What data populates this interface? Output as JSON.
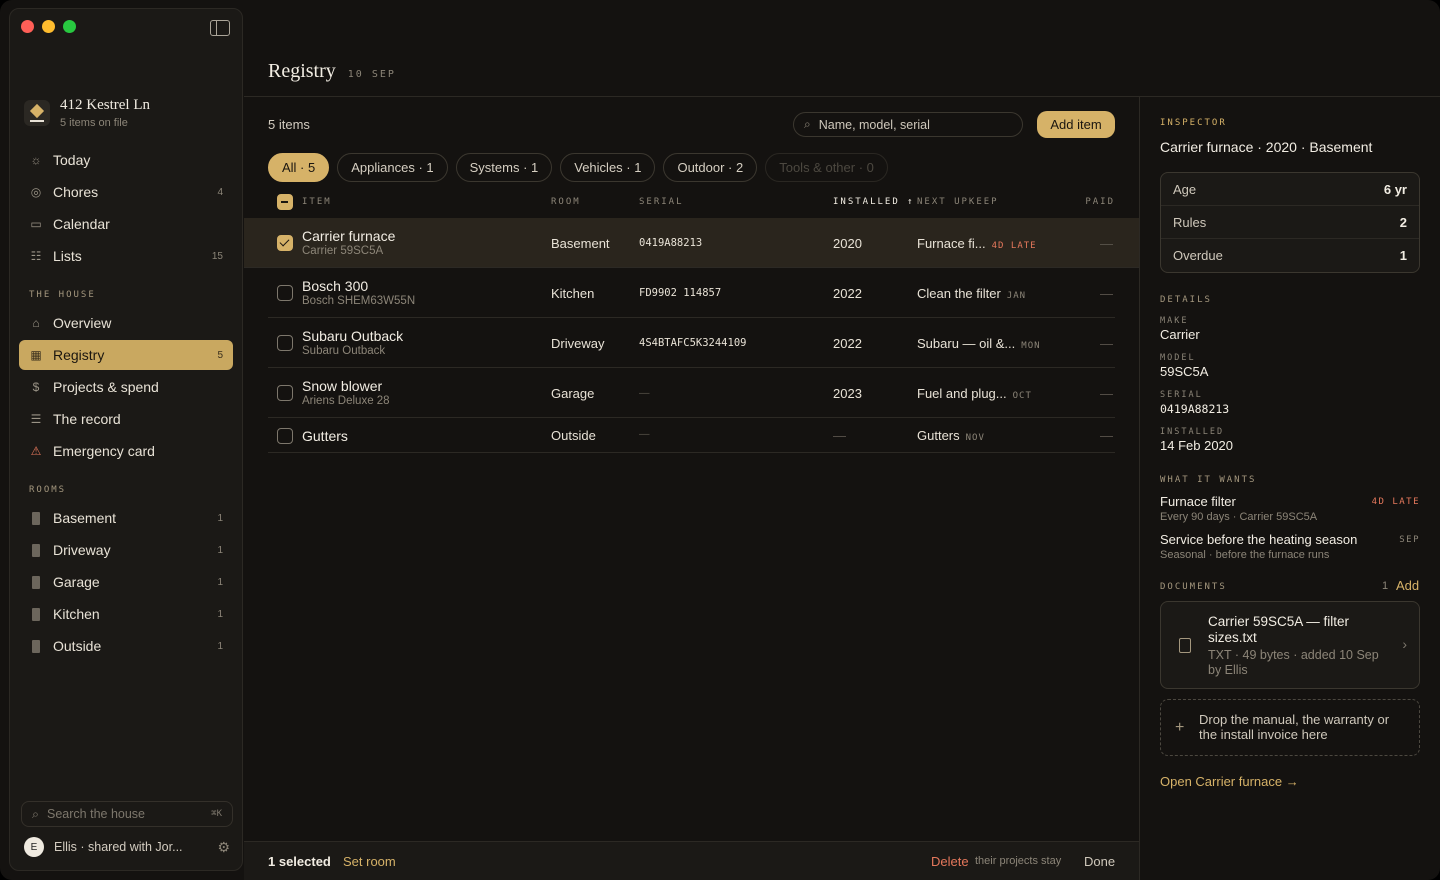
{
  "sidebar": {
    "house_name": "412 Kestrel Ln",
    "house_sub": "5 items on file",
    "nav": [
      {
        "label": "Today",
        "count": "",
        "icon": "sun-icon"
      },
      {
        "label": "Chores",
        "count": "4",
        "icon": "check-circle-icon"
      },
      {
        "label": "Calendar",
        "count": "",
        "icon": "calendar-icon"
      },
      {
        "label": "Lists",
        "count": "15",
        "icon": "list-icon"
      }
    ],
    "section_house": "THE HOUSE",
    "house_nav": [
      {
        "label": "Overview",
        "count": "",
        "icon": "home-icon"
      },
      {
        "label": "Registry",
        "count": "5",
        "icon": "grid-icon"
      },
      {
        "label": "Projects & spend",
        "count": "",
        "icon": "dollar-icon"
      },
      {
        "label": "The record",
        "count": "",
        "icon": "lines-icon"
      },
      {
        "label": "Emergency card",
        "count": "",
        "icon": "warning-icon"
      }
    ],
    "section_rooms": "ROOMS",
    "rooms": [
      {
        "label": "Basement",
        "count": "1"
      },
      {
        "label": "Driveway",
        "count": "1"
      },
      {
        "label": "Garage",
        "count": "1"
      },
      {
        "label": "Kitchen",
        "count": "1"
      },
      {
        "label": "Outside",
        "count": "1"
      }
    ],
    "search_placeholder": "Search the house",
    "search_kbd": "⌘K",
    "user_initial": "E",
    "user_label": "Ellis · shared with Jor..."
  },
  "header": {
    "title": "Registry",
    "date": "10 SEP"
  },
  "toolbar": {
    "item_count": "5 items",
    "search_placeholder": "Name, model, serial",
    "add_label": "Add item"
  },
  "chips": [
    "All · 5",
    "Appliances · 1",
    "Systems · 1",
    "Vehicles · 1",
    "Outdoor · 2",
    "Tools & other · 0"
  ],
  "columns": {
    "item": "ITEM",
    "room": "ROOM",
    "serial": "SERIAL",
    "installed": "INSTALLED ↑",
    "upkeep": "NEXT UPKEEP",
    "paid": "PAID"
  },
  "rows": [
    {
      "name": "Carrier furnace",
      "model": "Carrier 59SC5A",
      "room": "Basement",
      "serial": "0419A88213",
      "installed": "2020",
      "upkeep": "Furnace fi...",
      "tag": "4D LATE",
      "paid": "—"
    },
    {
      "name": "Bosch 300",
      "model": "Bosch SHEM63W55N",
      "room": "Kitchen",
      "serial": "FD9902 114857",
      "installed": "2022",
      "upkeep": "Clean the filter",
      "tag": "JAN",
      "paid": "—"
    },
    {
      "name": "Subaru Outback",
      "model": "Subaru Outback",
      "room": "Driveway",
      "serial": "4S4BTAFC5K3244109",
      "installed": "2022",
      "upkeep": "Subaru — oil &...",
      "tag": "MON",
      "paid": "—"
    },
    {
      "name": "Snow blower",
      "model": "Ariens Deluxe 28",
      "room": "Garage",
      "serial": "—",
      "installed": "2023",
      "upkeep": "Fuel and plug...",
      "tag": "OCT",
      "paid": "—"
    },
    {
      "name": "Gutters",
      "model": "",
      "room": "Outside",
      "serial": "—",
      "installed": "—",
      "upkeep": "Gutters",
      "tag": "NOV",
      "paid": "—"
    }
  ],
  "bottom": {
    "selected": "1 selected",
    "set_room": "Set room",
    "delete": "Delete",
    "delete_note": "their projects stay",
    "done": "Done"
  },
  "inspector": {
    "label": "INSPECTOR",
    "title": "Carrier furnace · 2020 · Basement",
    "stats": [
      {
        "k": "Age",
        "v": "6 yr"
      },
      {
        "k": "Rules",
        "v": "2"
      },
      {
        "k": "Overdue",
        "v": "1"
      }
    ],
    "details_label": "DETAILS",
    "make_label": "MAKE",
    "make": "Carrier",
    "model_label": "MODEL",
    "model": "59SC5A",
    "serial_label": "SERIAL",
    "serial": "0419A88213",
    "installed_label": "INSTALLED",
    "installed": "14 Feb 2020",
    "wants_label": "WHAT IT WANTS",
    "wants": [
      {
        "title": "Furnace filter",
        "desc": "Every 90 days · Carrier 59SC5A",
        "when": "4D LATE"
      },
      {
        "title": "Service before the heating season",
        "desc": "Seasonal · before the furnace runs",
        "when": "SEP"
      }
    ],
    "docs_label": "DOCUMENTS",
    "docs_count": "1",
    "docs_add": "Add",
    "doc_title": "Carrier 59SC5A — filter sizes.txt",
    "doc_meta": "TXT · 49 bytes · added 10 Sep by Ellis",
    "drop_text": "Drop the manual, the warranty or the install invoice here",
    "open_link": "Open Carrier furnace →"
  },
  "colors": {
    "accent": "#d6b268",
    "late": "#e5785c",
    "bg": "#141210"
  }
}
